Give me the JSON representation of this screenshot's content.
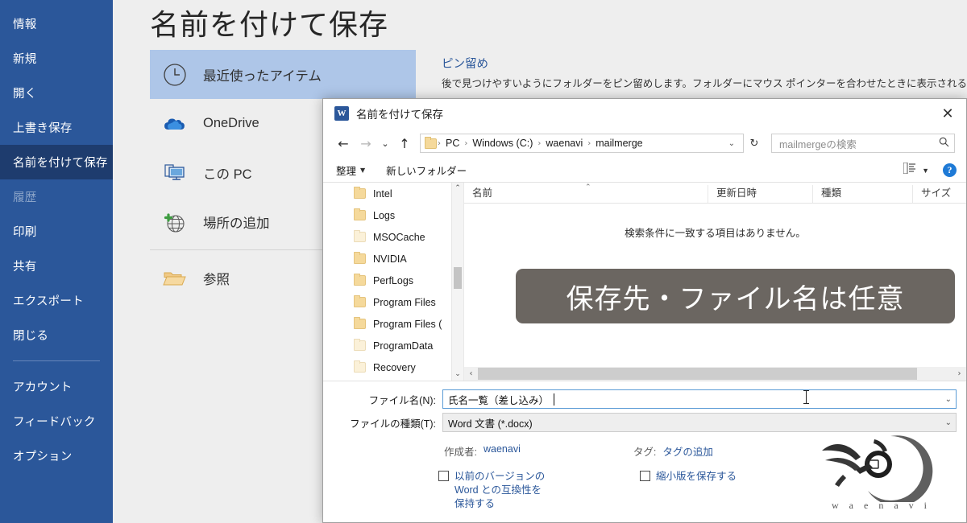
{
  "backstage": {
    "nav_items": [
      {
        "label": "情報",
        "state": "normal"
      },
      {
        "label": "新規",
        "state": "normal"
      },
      {
        "label": "開く",
        "state": "normal"
      },
      {
        "label": "上書き保存",
        "state": "normal"
      },
      {
        "label": "名前を付けて保存",
        "state": "selected"
      },
      {
        "label": "履歴",
        "state": "disabled"
      },
      {
        "label": "印刷",
        "state": "normal"
      },
      {
        "label": "共有",
        "state": "normal"
      },
      {
        "label": "エクスポート",
        "state": "normal"
      },
      {
        "label": "閉じる",
        "state": "normal"
      }
    ],
    "nav_items_bottom": [
      {
        "label": "アカウント",
        "state": "normal"
      },
      {
        "label": "フィードバック",
        "state": "normal"
      },
      {
        "label": "オプション",
        "state": "normal"
      }
    ],
    "page_title": "名前を付けて保存",
    "places": [
      {
        "label": "最近使ったアイテム",
        "icon": "clock-icon",
        "active": true
      },
      {
        "label": "OneDrive",
        "icon": "cloud-icon",
        "active": false
      },
      {
        "label": "この PC",
        "icon": "monitor-icon",
        "active": false
      },
      {
        "label": "場所の追加",
        "icon": "add-place-globe-icon",
        "active": false
      },
      {
        "label": "参照",
        "icon": "open-folder-icon",
        "active": false
      }
    ],
    "pin": {
      "title": "ピン留め",
      "description": "後で見つけやすいようにフォルダーをピン留めします。フォルダーにマウス ポインターを合わせたときに表示されるピンのアイコンを"
    },
    "accent_color": "#2b579a",
    "selected_color": "#1e3c6e",
    "place_active_color": "#aec6e8"
  },
  "dialog": {
    "title": "名前を付けて保存",
    "app_icon_letter": "W",
    "close_label": "✕",
    "address": {
      "back_label": "←",
      "forward_label": "→",
      "history_label": "⌄",
      "up_label": "↑",
      "crumbs": [
        "PC",
        "Windows (C:)",
        "waenavi",
        "mailmerge"
      ],
      "separator": "›",
      "dropdown_label": "⌄",
      "refresh_label": "↻"
    },
    "search": {
      "placeholder": "mailmergeの検索",
      "icon": "search-icon"
    },
    "commandbar": {
      "organize_label": "整理",
      "organize_caret": "▼",
      "new_folder_label": "新しいフォルダー",
      "view_caret": "▼",
      "help_label": "?"
    },
    "tree": {
      "items": [
        {
          "label": "Intel",
          "pale": false
        },
        {
          "label": "Logs",
          "pale": false
        },
        {
          "label": "MSOCache",
          "pale": true
        },
        {
          "label": "NVIDIA",
          "pale": false
        },
        {
          "label": "PerfLogs",
          "pale": false
        },
        {
          "label": "Program Files",
          "pale": false
        },
        {
          "label": "Program Files (",
          "pale": false
        },
        {
          "label": "ProgramData",
          "pale": true
        },
        {
          "label": "Recovery",
          "pale": true
        }
      ],
      "scroll_up": "⌃",
      "scroll_down": "⌄"
    },
    "filelist": {
      "columns": [
        "名前",
        "更新日時",
        "種類",
        "サイズ"
      ],
      "sort_caret": "⌃",
      "empty_message": "検索条件に一致する項目はありません。",
      "hscroll_left": "‹",
      "hscroll_right": "›"
    },
    "form": {
      "filename_label": "ファイル名(N):",
      "filename_value": "氏名一覧（差し込み）",
      "filetype_label": "ファイルの種類(T):",
      "filetype_value": "Word 文書 (*.docx)",
      "combo_caret": "⌄",
      "author_key": "作成者:",
      "author_value": "waenavi",
      "tags_key": "タグ:",
      "tags_value": "タグの追加",
      "compat_checkbox_label": "以前のバージョンの Word との互換性を保持する",
      "thumbnail_checkbox_label": "縮小版を保存する"
    }
  },
  "caption": {
    "text": "保存先・ファイル名は任意",
    "background": "#6b6661",
    "color": "#ffffff"
  },
  "watermark": {
    "text": "w a e n a v i"
  }
}
